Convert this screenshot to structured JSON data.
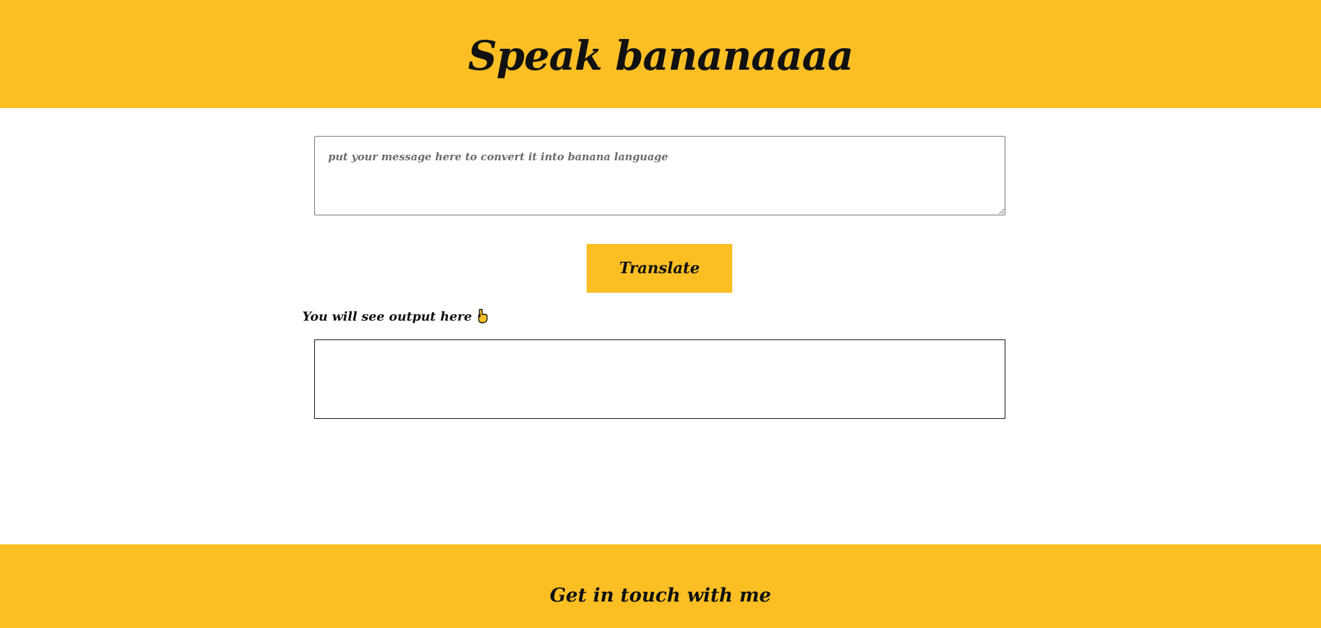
{
  "header": {
    "title": "Speak bananaaaa"
  },
  "input": {
    "placeholder": "put your message here to convert it into banana language",
    "value": ""
  },
  "translate_button": {
    "label": "Translate"
  },
  "output": {
    "label": "You will see output here",
    "icon": "pointing-down-icon",
    "text": ""
  },
  "footer": {
    "heading": "Get in touch with me"
  },
  "colors": {
    "accent": "#fbbf24",
    "text": "#111111"
  }
}
